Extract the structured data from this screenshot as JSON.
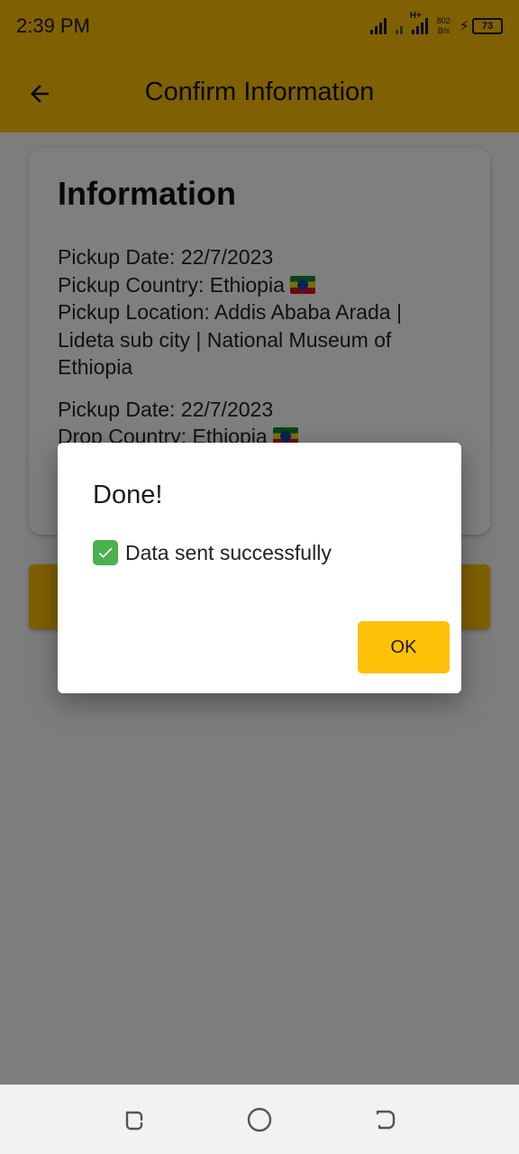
{
  "status_bar": {
    "time": "2:39 PM",
    "network_type": "H+",
    "speed_value": "802",
    "speed_unit": "B/s",
    "battery": "73"
  },
  "app_bar": {
    "title": "Confirm Information"
  },
  "card": {
    "title": "Information",
    "block1": {
      "pickup_date": "Pickup Date: 22/7/2023",
      "pickup_country": "Pickup Country: Ethiopia",
      "pickup_location": "Pickup Location: Addis Ababa Arada | Lideta sub city | National Museum of Ethiopia"
    },
    "block2": {
      "pickup_date": "Pickup Date: 22/7/2023",
      "drop_country": "Drop Country: Ethiopia"
    }
  },
  "dialog": {
    "title": "Done!",
    "message": "Data sent successfully",
    "ok_label": "OK"
  },
  "colors": {
    "accent": "#ffc107",
    "scrim": "rgba(0,0,0,0.5)",
    "success": "#4caf50"
  },
  "icons": [
    "back-arrow-icon",
    "check-icon",
    "ethiopia-flag-icon",
    "recent-apps-icon",
    "home-icon",
    "back-nav-icon"
  ]
}
